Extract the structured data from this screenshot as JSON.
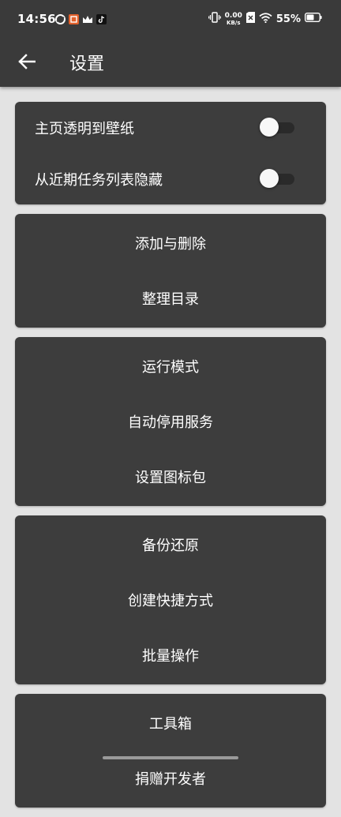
{
  "status_bar": {
    "time": "14:56",
    "net_speed_value": "0.00",
    "net_speed_unit": "KB/s",
    "battery": "55%"
  },
  "toolbar": {
    "title": "设置"
  },
  "toggles": [
    {
      "label": "主页透明到壁纸",
      "on": false
    },
    {
      "label": "从近期任务列表隐藏",
      "on": false
    }
  ],
  "groups": [
    {
      "items": [
        "添加与删除",
        "整理目录"
      ]
    },
    {
      "items": [
        "运行模式",
        "自动停用服务",
        "设置图标包"
      ]
    },
    {
      "items": [
        "备份还原",
        "创建快捷方式",
        "批量操作"
      ]
    },
    {
      "items": [
        "工具箱",
        "捐赠开发者"
      ]
    }
  ],
  "colors": {
    "app_bar": "#3a3a3a",
    "background": "#e3e3e3",
    "card": "#3d3d3d"
  }
}
